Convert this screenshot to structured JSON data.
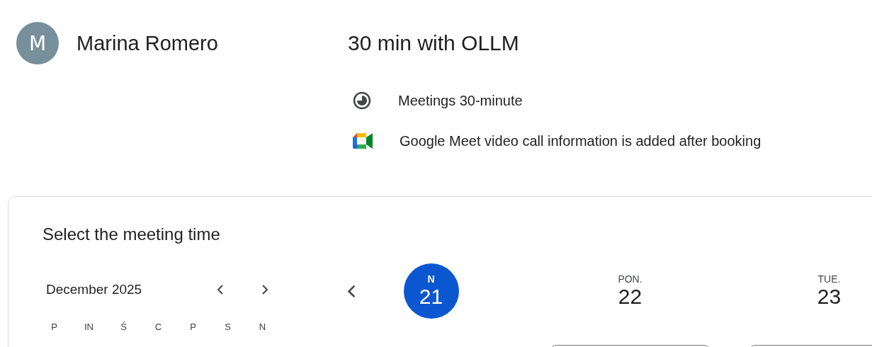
{
  "host": {
    "initial": "M",
    "name": "Marina Romero"
  },
  "event": {
    "title": "30 min with OLLM",
    "details": [
      {
        "kind": "duration",
        "text": "Meetings 30-minute"
      },
      {
        "kind": "video",
        "text": "Google Meet video call information is added after booking"
      }
    ]
  },
  "booking": {
    "heading": "Select the meeting time",
    "month": {
      "label": "December 2025",
      "weekdays": [
        "P",
        "IN",
        "Ś",
        "C",
        "P",
        "S",
        "N"
      ]
    },
    "days": [
      {
        "weekday": "N",
        "date": "21",
        "selected": true
      },
      {
        "weekday": "PON.",
        "date": "22",
        "selected": false
      },
      {
        "weekday": "TUE.",
        "date": "23",
        "selected": false
      }
    ]
  }
}
